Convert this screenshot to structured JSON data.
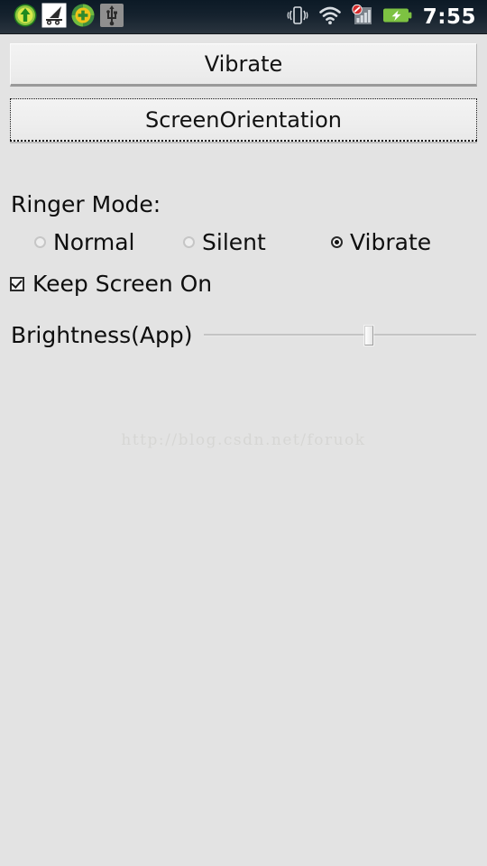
{
  "statusbar": {
    "time": "7:55",
    "left_icons": [
      {
        "name": "download-arrow-icon",
        "label": "Download complete"
      },
      {
        "name": "adb-debug-icon",
        "label": "USB debugging connected"
      },
      {
        "name": "sync-plus-icon",
        "label": "App update available"
      },
      {
        "name": "usb-icon",
        "label": "USB connected"
      }
    ],
    "right_icons": [
      {
        "name": "vibrate-icon",
        "label": "Vibrate mode"
      },
      {
        "name": "wifi-icon",
        "label": "Wi-Fi connected"
      },
      {
        "name": "signal-no-service-icon",
        "label": "No SIM / no service"
      },
      {
        "name": "battery-charging-icon",
        "label": "Battery charging"
      }
    ]
  },
  "main": {
    "vibrate_button": "Vibrate",
    "orientation_button": "ScreenOrientation",
    "ringer_label": "Ringer Mode:",
    "ringer_options": [
      {
        "label": "Normal",
        "checked": false
      },
      {
        "label": "Silent",
        "checked": false
      },
      {
        "label": "Vibrate",
        "checked": true
      }
    ],
    "keep_screen_on": {
      "label": "Keep Screen On",
      "checked": true
    },
    "brightness": {
      "label": "Brightness(App)",
      "value_percent": 61,
      "min": 0,
      "max": 100
    },
    "watermark": "http://blog.csdn.net/foruok"
  },
  "colors": {
    "page_background": "#e3e3e3",
    "statusbar_background": "#15222e",
    "button_face": "#eeeeee",
    "text": "#0e0e0e",
    "battery_green": "#7dc242",
    "watermark": "#d6d6d4"
  }
}
